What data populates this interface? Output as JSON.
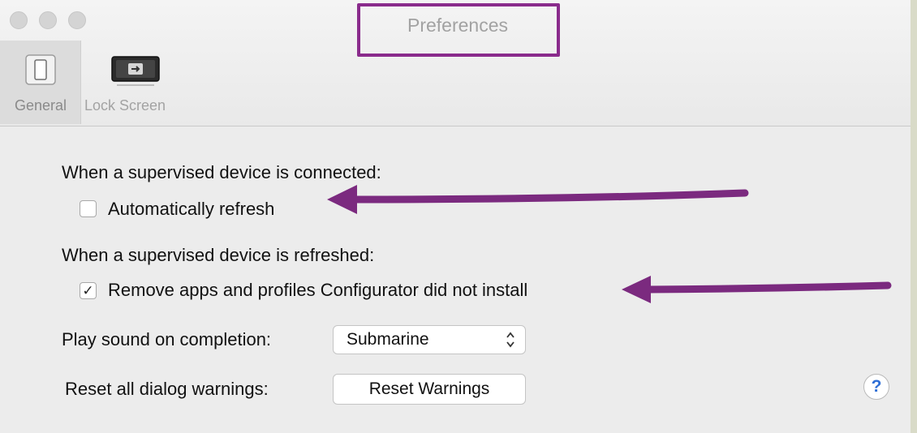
{
  "window": {
    "title": "Preferences"
  },
  "toolbar": {
    "tabs": [
      {
        "label": "General",
        "icon": "switch-icon",
        "selected": true
      },
      {
        "label": "Lock Screen",
        "icon": "lock-screen-icon",
        "selected": false
      }
    ]
  },
  "general": {
    "connected_heading": "When a supervised device is connected:",
    "auto_refresh": {
      "label": "Automatically refresh",
      "checked": false
    },
    "refreshed_heading": "When a supervised device is refreshed:",
    "remove_apps": {
      "label": "Remove apps and profiles Configurator did not install",
      "checked": true,
      "check_glyph": "✓"
    },
    "sound": {
      "label": "Play sound on completion:",
      "selected": "Submarine",
      "arrows": "⌃⌄"
    },
    "reset": {
      "label": "Reset all dialog warnings:",
      "button_label": "Reset Warnings"
    },
    "help": {
      "label": "?"
    }
  },
  "annotations": {
    "highlight_color": "#8a2b8c",
    "arrow_color": "#7b2a7f"
  }
}
